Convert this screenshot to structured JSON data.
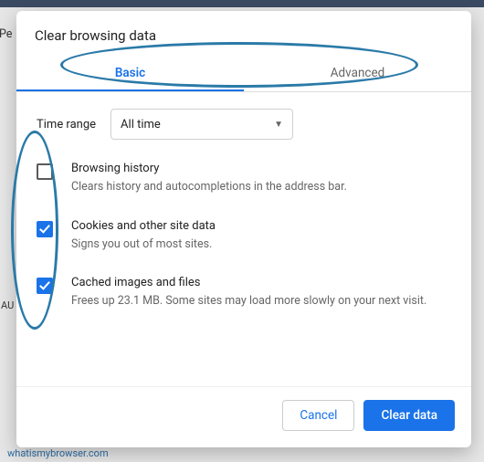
{
  "dialog": {
    "title": "Clear browsing data",
    "tabs": {
      "basic": "Basic",
      "advanced": "Advanced"
    },
    "range": {
      "label": "Time range",
      "value": "All time"
    },
    "options": {
      "browsing_history": {
        "title": "Browsing history",
        "desc": "Clears history and autocompletions in the address bar.",
        "checked": false
      },
      "cookies": {
        "title": "Cookies and other site data",
        "desc": "Signs you out of most sites.",
        "checked": true
      },
      "cache": {
        "title": "Cached images and files",
        "desc": "Frees up 23.1 MB. Some sites may load more slowly on your next visit.",
        "checked": true
      }
    },
    "buttons": {
      "cancel": "Cancel",
      "clear": "Clear data"
    }
  },
  "background": {
    "au": "AU",
    "pe": "Pe",
    "footer_link": "whatismybrowser.com"
  }
}
